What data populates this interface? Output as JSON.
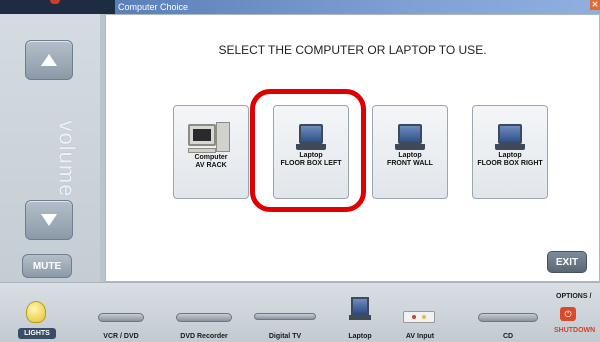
{
  "dialog": {
    "title": "Computer Choice",
    "close_icon": "close-icon",
    "instruction": "SELECT THE COMPUTER OR LAPTOP TO USE.",
    "choices": [
      {
        "line1": "Computer",
        "line2": "AV RACK",
        "icon": "desktop-computer-icon"
      },
      {
        "line1": "Laptop",
        "line2": "FLOOR BOX LEFT",
        "icon": "laptop-icon",
        "highlighted": true
      },
      {
        "line1": "Laptop",
        "line2": "FRONT WALL",
        "icon": "laptop-icon"
      },
      {
        "line1": "Laptop",
        "line2": "FLOOR BOX RIGHT",
        "icon": "laptop-icon"
      }
    ],
    "exit_label": "EXIT",
    "highlight_color": "#e00000"
  },
  "sidebar": {
    "volume_label": "volume",
    "mute_label": "MUTE",
    "up_icon": "arrow-up-icon",
    "down_icon": "arrow-down-icon"
  },
  "bottom": {
    "lights_label": "LIGHTS",
    "items": [
      {
        "label": "VCR / DVD",
        "icon": "vcr-icon"
      },
      {
        "label": "DVD Recorder",
        "icon": "dvd-recorder-icon"
      },
      {
        "label": "Digital TV",
        "icon": "digital-tv-icon"
      },
      {
        "label": "Laptop",
        "icon": "laptop-icon"
      },
      {
        "label": "AV Input",
        "icon": "av-input-icon"
      },
      {
        "label": "CD",
        "icon": "cd-icon"
      }
    ],
    "options_label": "OPTIONS /",
    "shutdown_label": "SHUTDOWN"
  },
  "colors": {
    "title_bar": "#6c8fc7",
    "panel": "#c5cdd4",
    "accent_red": "#e00000"
  }
}
